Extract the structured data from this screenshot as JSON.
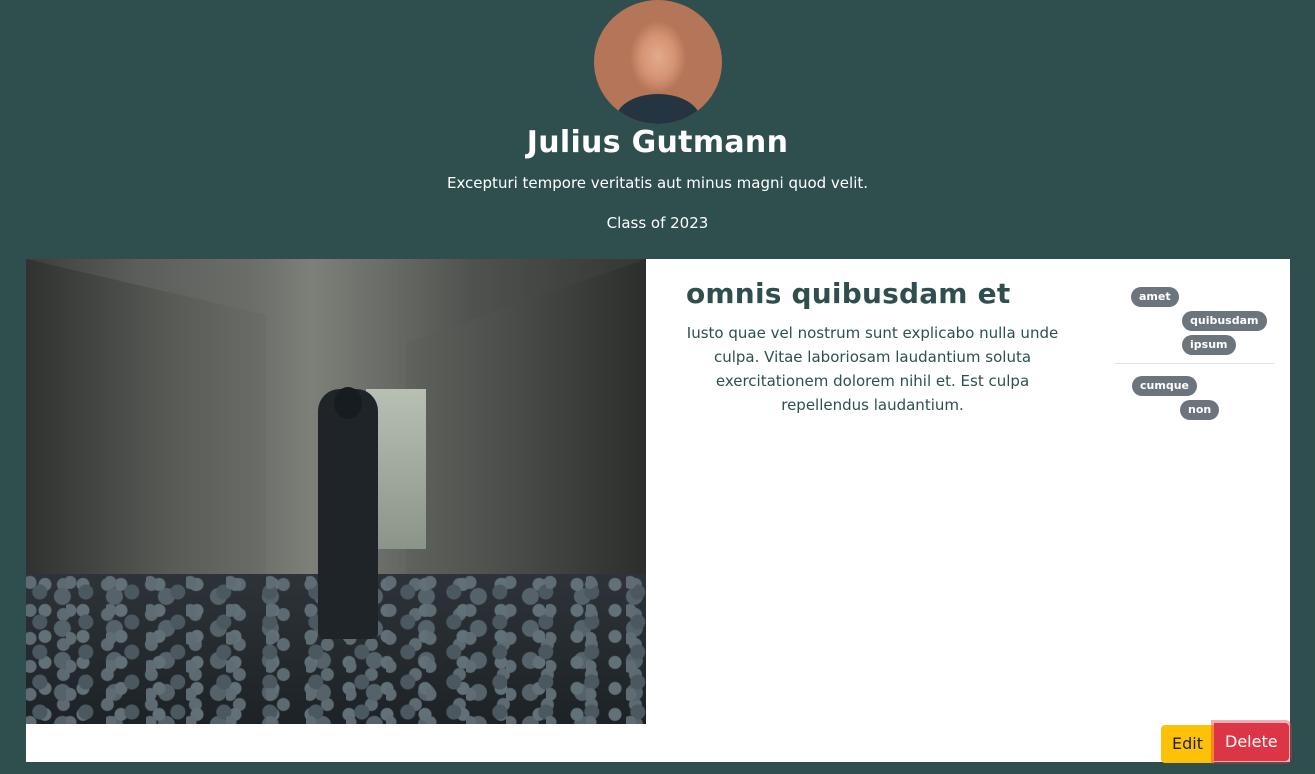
{
  "profile": {
    "name": "Julius Gutmann",
    "bio": "Excepturi tempore veritatis aut minus magni quod velit.",
    "class_year": "Class of 2023"
  },
  "post": {
    "title": "omnis quibusdam et",
    "body": "Iusto quae vel nostrum sunt explicabo nulla unde culpa. Vitae laboriosam laudantium soluta exercitationem dolorem nihil et. Est culpa repellendus laudantium.",
    "tags_group_1": [
      "amet",
      "quibusdam",
      "ipsum"
    ],
    "tags_group_2": [
      "cumque",
      "non"
    ]
  },
  "actions": {
    "edit_label": "Edit",
    "delete_label": "Delete"
  },
  "colors": {
    "page_background": "#2f4f4f",
    "edit_button": "#ffc107",
    "delete_button": "#dc3545",
    "tag_badge": "#6c757d"
  }
}
